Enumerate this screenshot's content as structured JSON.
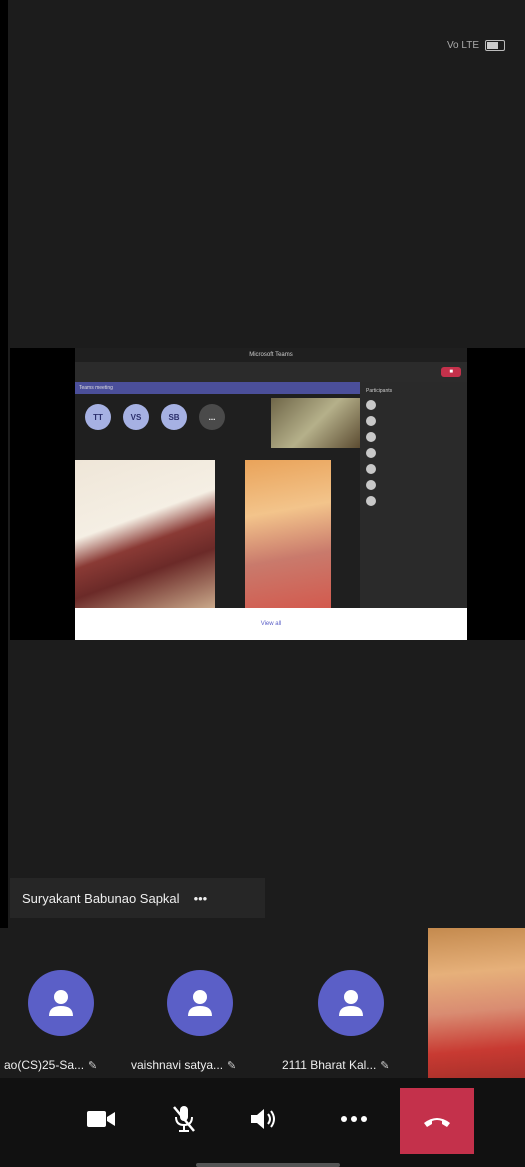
{
  "status": {
    "network": "Vo LTE"
  },
  "share": {
    "window_title": "Microsoft Teams",
    "banner_text": "Teams meeting",
    "avatars": [
      "TT",
      "VS",
      "SB",
      "..."
    ],
    "participants_header": "Participants",
    "foot_link": "View all"
  },
  "speaker": {
    "name": "Suryakant Babunao Sapkal",
    "more": "•••"
  },
  "strip": [
    {
      "name": "ao(CS)25-Sa..."
    },
    {
      "name": "vaishnavi satya..."
    },
    {
      "name": "2111 Bharat Kal..."
    }
  ],
  "controls": {
    "camera_icon": "camera-icon",
    "mic_icon": "mic-off-icon",
    "speaker_icon": "speaker-icon",
    "more_icon": "more-icon",
    "hangup_icon": "hangup-icon",
    "hangup_color": "#c4314b"
  }
}
